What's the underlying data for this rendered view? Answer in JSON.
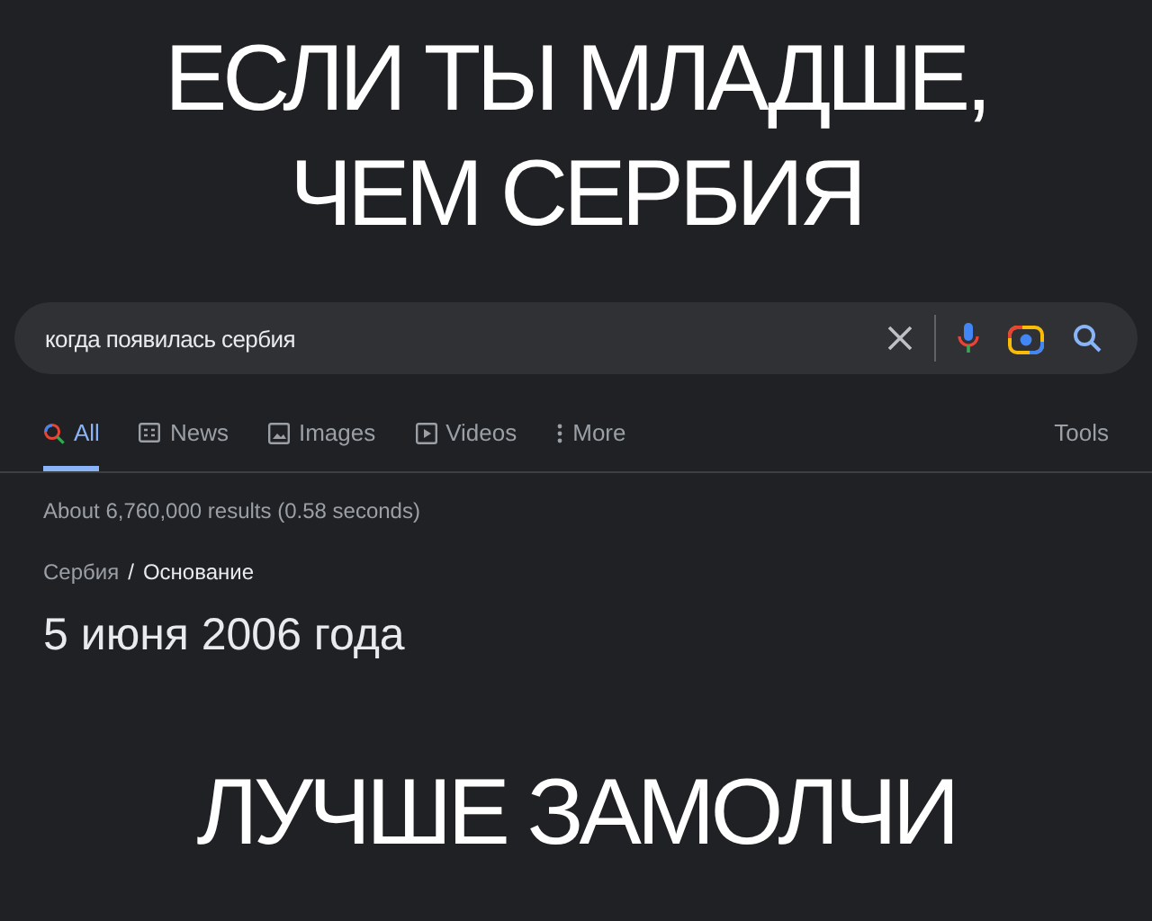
{
  "caption_top": [
    "ЕСЛИ ТЫ МЛАДШЕ,",
    "ЧЕМ СЕРБИЯ"
  ],
  "search": {
    "value": "когда появилась сербия"
  },
  "tabs": [
    {
      "label": "All",
      "kind": "all",
      "selected": true
    },
    {
      "label": "News",
      "kind": "news",
      "selected": false
    },
    {
      "label": "Images",
      "kind": "images",
      "selected": false
    },
    {
      "label": "Videos",
      "kind": "videos",
      "selected": false
    },
    {
      "label": "More",
      "kind": "more",
      "selected": false
    }
  ],
  "tools": "Tools",
  "result_stats": "About 6,760,000 results (0.58 seconds)",
  "breadcrumb": {
    "parent": "Сербия",
    "separator": "/",
    "current": "Основание"
  },
  "answer": "5 июня 2006 года",
  "caption_bottom": "ЛУЧШЕ ЗАМОЛЧИ"
}
